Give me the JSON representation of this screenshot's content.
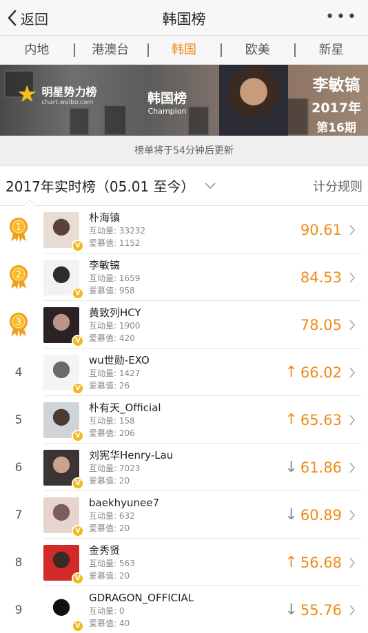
{
  "nav": {
    "back_label": "返回",
    "title": "韩国榜",
    "more": "•••"
  },
  "tabs": [
    "内地",
    "港澳台",
    "韩国",
    "欧美",
    "新星"
  ],
  "active_tab": 2,
  "banner": {
    "brand": "明星势力榜",
    "brand_url": "chart.weibo.com",
    "badge_title": "韩国榜",
    "badge_sub": "Champion",
    "champion_name": "李敏镐",
    "year": "2017年",
    "issue": "第16期"
  },
  "notice": "榜单将于54分钟后更新",
  "subbar": {
    "period": "2017年实时榜（05.01 至今）",
    "rules": "计分规则"
  },
  "labels": {
    "interaction": "互动量: ",
    "fans": "爱慕值: "
  },
  "colors": {
    "accent": "#f08a18",
    "gold": "#f5b71e"
  },
  "ranking": [
    {
      "rank": "1",
      "medal": true,
      "name": "朴海镇",
      "interaction": "33232",
      "fans": "1152",
      "score": "90.61",
      "trend": "",
      "avatar": [
        "#e9ddd3",
        "#5a4336"
      ]
    },
    {
      "rank": "2",
      "medal": true,
      "name": "李敏镐",
      "interaction": "1659",
      "fans": "958",
      "score": "84.53",
      "trend": "",
      "avatar": [
        "#f2f2f2",
        "#2d2d2d"
      ]
    },
    {
      "rank": "3",
      "medal": true,
      "name": "黄致列HCY",
      "interaction": "1900",
      "fans": "420",
      "score": "78.05",
      "trend": "",
      "avatar": [
        "#2a2224",
        "#b99585"
      ]
    },
    {
      "rank": "4",
      "medal": false,
      "name": "wu世勋-EXO",
      "interaction": "1427",
      "fans": "26",
      "score": "66.02",
      "trend": "up",
      "avatar": [
        "#f4f4f4",
        "#6a6a6a"
      ]
    },
    {
      "rank": "5",
      "medal": false,
      "name": "朴有天_Official",
      "interaction": "158",
      "fans": "206",
      "score": "65.63",
      "trend": "up",
      "avatar": [
        "#cfd4d8",
        "#4a3a32"
      ]
    },
    {
      "rank": "6",
      "medal": false,
      "name": "刘宪华Henry-Lau",
      "interaction": "7023",
      "fans": "20",
      "score": "61.86",
      "trend": "down",
      "avatar": [
        "#3a3432",
        "#c9a38c"
      ]
    },
    {
      "rank": "7",
      "medal": false,
      "name": "baekhyunee7",
      "interaction": "632",
      "fans": "20",
      "score": "60.89",
      "trend": "down",
      "avatar": [
        "#e8d4cf",
        "#7b5e5c"
      ]
    },
    {
      "rank": "8",
      "medal": false,
      "name": "金秀贤",
      "interaction": "563",
      "fans": "20",
      "score": "56.68",
      "trend": "up",
      "avatar": [
        "#d22a2a",
        "#3a2a26"
      ]
    },
    {
      "rank": "9",
      "medal": false,
      "name": "GDRAGON_OFFICIAL",
      "interaction": "0",
      "fans": "40",
      "score": "55.76",
      "trend": "down",
      "avatar": [
        "#ffffff",
        "#111111"
      ]
    }
  ]
}
